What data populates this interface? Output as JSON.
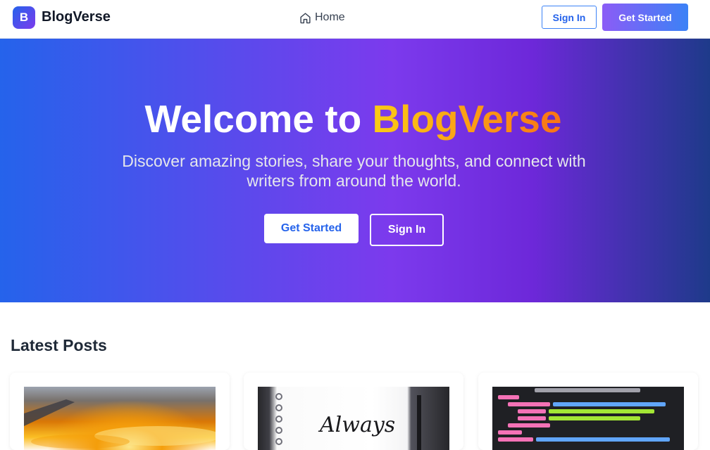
{
  "navbar": {
    "logo_letter": "B",
    "brand_name": "BlogVerse",
    "home_label": "Home",
    "signin_label": "Sign In",
    "get_started_label": "Get Started"
  },
  "hero": {
    "title_prefix": "Welcome to ",
    "title_accent": "BlogVerse",
    "subtitle": "Discover amazing stories, share your thoughts, and connect with writers from around the world.",
    "primary_button": "Get Started",
    "secondary_button": "Sign In"
  },
  "latest": {
    "title": "Latest Posts",
    "cards": [
      {
        "image": "sunset-sky-from-airplane"
      },
      {
        "image": "notebook-always-lettering",
        "image_text": "Always"
      },
      {
        "image": "code-editor-svg"
      }
    ]
  },
  "colors": {
    "brand_blue": "#2563eb",
    "brand_purple": "#7c3aed",
    "accent_yellow": "#facc15",
    "accent_orange": "#f97316"
  },
  "icons": {
    "home": "home-icon"
  }
}
